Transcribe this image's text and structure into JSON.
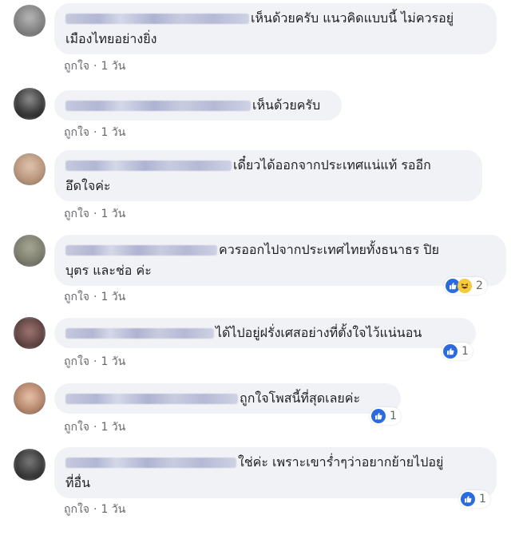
{
  "comments": [
    {
      "lines": [
        "เห็นด้วยครับ แนวคิดแบบนี้ ไม่ควรอยู่",
        "เมืองไทยอย่างยิ่ง"
      ],
      "like_label": "ถูกใจ",
      "separator": "·",
      "time": "1 วัน",
      "reaction_count": null,
      "avatar_color": "#8a8a8a"
    },
    {
      "lines": [
        "เห็นด้วยครับ"
      ],
      "like_label": "ถูกใจ",
      "separator": "·",
      "time": "1 วัน",
      "reaction_count": null,
      "avatar_color": "#2e2e2e"
    },
    {
      "lines": [
        "เดี๋ยวได้ออกจากประเทศแน่แท้ รออีก",
        "อึดใจค่ะ"
      ],
      "like_label": "ถูกใจ",
      "separator": "·",
      "time": "1 วัน",
      "reaction_count": null,
      "avatar_color": "#c9a98e"
    },
    {
      "lines": [
        "ควรออกไปจากประเทศไทยทั้งธนาธร ปิย",
        "บุตร และช่อ ค่ะ"
      ],
      "like_label": "ถูกใจ",
      "separator": "·",
      "time": "1 วัน",
      "reaction_count": "2",
      "reaction_icons": [
        "like-icon",
        "haha-icon"
      ],
      "avatar_color": "#7c7d72"
    },
    {
      "lines": [
        "ได้ไปอยู่ฝรั่งเศสอย่างที่ตั้งใจไว้แน่นอน"
      ],
      "like_label": "ถูกใจ",
      "separator": "·",
      "time": "1 วัน",
      "reaction_count": "1",
      "reaction_icons": [
        "like-icon"
      ],
      "avatar_color": "#6a4a46"
    },
    {
      "lines": [
        "ถูกใจโพสนี้ที่สุดเลยค่ะ"
      ],
      "like_label": "ถูกใจ",
      "separator": "·",
      "time": "1 วัน",
      "reaction_count": "1",
      "reaction_icons": [
        "like-icon"
      ],
      "avatar_color": "#b98a70"
    },
    {
      "lines": [
        "ใช่ค่ะ เพราะเขาร่ำๆว่าอยากย้ายไปอยู่",
        "ที่อื่น"
      ],
      "like_label": "ถูกใจ",
      "separator": "·",
      "time": "1 วัน",
      "reaction_count": "1",
      "reaction_icons": [
        "like-icon"
      ],
      "avatar_color": "#3b3b3b"
    }
  ],
  "colors": {
    "bubble_bg": "#f1f2f6",
    "text": "#1c1e21",
    "meta": "#65676b",
    "like_blue": "#2a6ce0",
    "haha_yellow": "#f7c93d"
  }
}
